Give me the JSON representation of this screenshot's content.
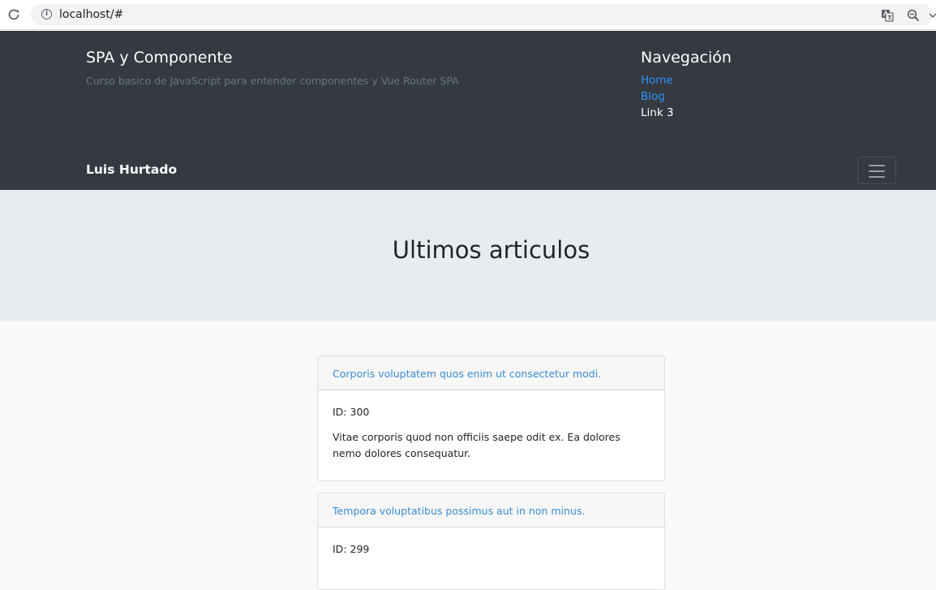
{
  "browser": {
    "url": "localhost/#",
    "info_glyph": "i",
    "icons": [
      "reload-icon",
      "info-icon",
      "translate-icon",
      "zoom-icon",
      "menu-caret-icon"
    ]
  },
  "header": {
    "title": "SPA y Componente",
    "description": "Curso basico de JavaScript para entender componentes y Vue Router SPA",
    "nav_heading": "Navegación",
    "nav_links": [
      "Home",
      "Blog",
      "Link 3"
    ],
    "brand": "Luis Hurtado"
  },
  "jumbotron": {
    "title": "Ultimos articulos"
  },
  "articles": [
    {
      "title": "Corporis voluptatem quos enim ut consectetur modi.",
      "id_text": "ID: 300",
      "body": "Vitae corporis quod non officiis saepe odit ex. Ea dolores nemo dolores consequatur."
    },
    {
      "title": "Tempora voluptatibus possimus aut in non minus.",
      "id_text": "ID: 299",
      "body": ""
    }
  ],
  "colors": {
    "header_bg": "#343a40",
    "link_blue": "#2f94f5",
    "jumbotron_bg": "#e9ecef",
    "page_bg": "#f8f9fa"
  }
}
